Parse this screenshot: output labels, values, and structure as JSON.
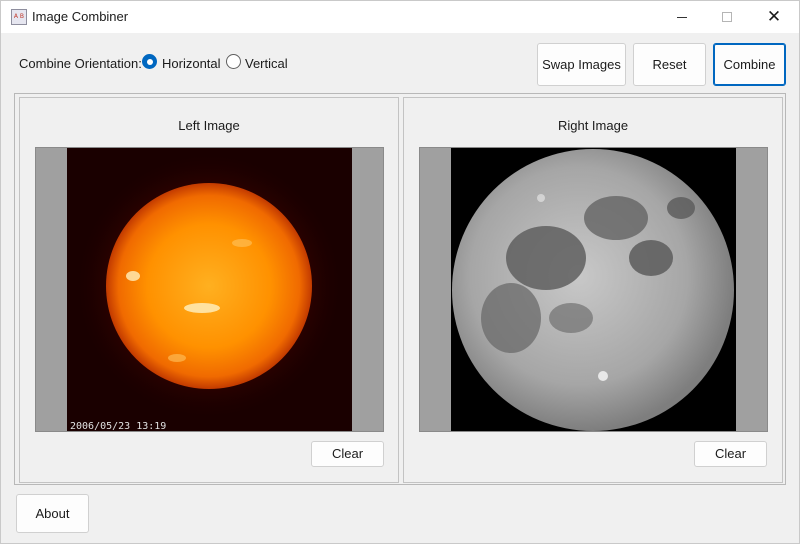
{
  "window": {
    "title": "Image Combiner",
    "icon": "image-combiner-app-icon",
    "controls": {
      "minimize": "minimize-icon",
      "maximize": "maximize-icon",
      "close": "close-icon",
      "close_glyph": "✕"
    }
  },
  "orientation": {
    "label": "Combine Orientation:",
    "options": [
      {
        "label": "Horizontal",
        "selected": true
      },
      {
        "label": "Vertical",
        "selected": false
      }
    ]
  },
  "toolbar": {
    "swap_label": "Swap Images",
    "reset_label": "Reset",
    "combine_label": "Combine"
  },
  "left_panel": {
    "title": "Left Image",
    "image": "sun-photo",
    "image_caption": "2006/05/23  13:19",
    "clear_label": "Clear"
  },
  "right_panel": {
    "title": "Right Image",
    "image": "moon-photo",
    "clear_label": "Clear"
  },
  "about_label": "About",
  "colors": {
    "accent": "#0067c0",
    "window_bg": "#f0f0f0",
    "letterbox": "#a0a0a0"
  }
}
